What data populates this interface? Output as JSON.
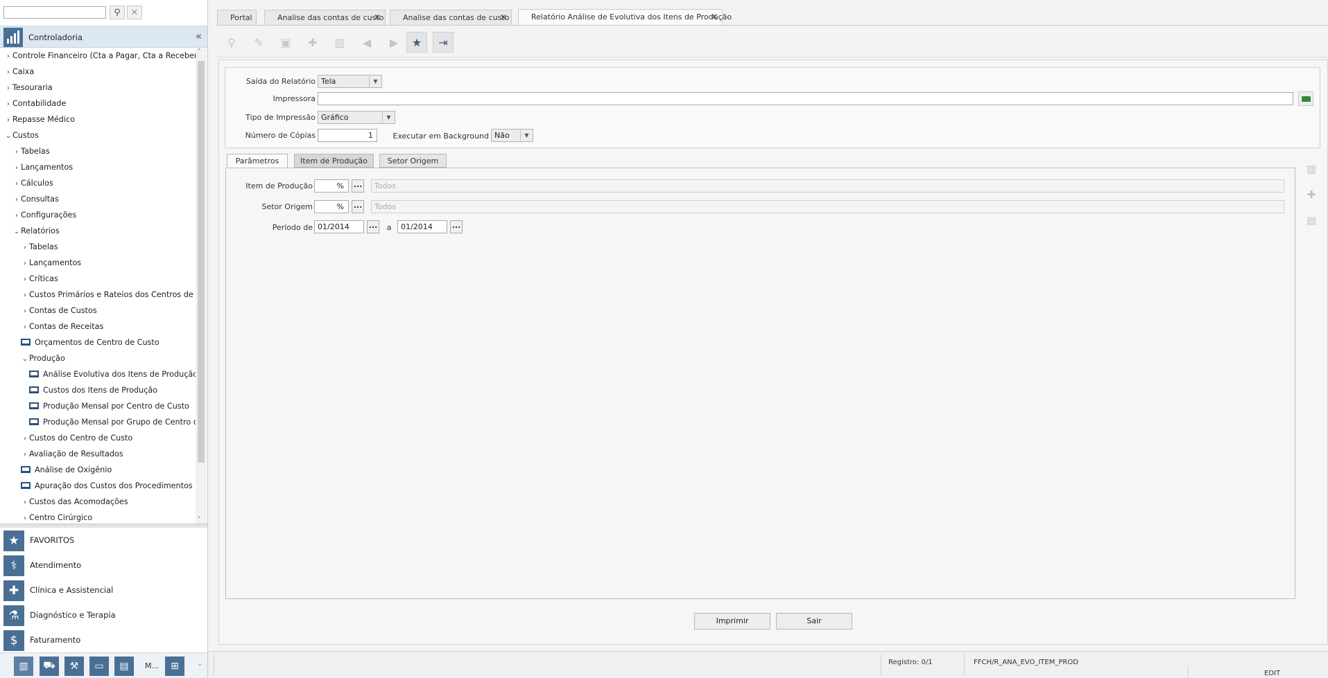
{
  "left_panel": {
    "search_placeholder": "",
    "module_title": "Controladoria",
    "collapse_glyph": "«",
    "tree": [
      {
        "label": "Controle Financeiro (Cta a Pagar, Cta a Receber, Banc",
        "level": 0,
        "state": "collapsed"
      },
      {
        "label": "Caixa",
        "level": 0,
        "state": "collapsed"
      },
      {
        "label": "Tesouraria",
        "level": 0,
        "state": "collapsed"
      },
      {
        "label": "Contabilidade",
        "level": 0,
        "state": "collapsed"
      },
      {
        "label": "Repasse Médico",
        "level": 0,
        "state": "collapsed"
      },
      {
        "label": "Custos",
        "level": 0,
        "state": "expanded"
      },
      {
        "label": "Tabelas",
        "level": 1,
        "state": "collapsed"
      },
      {
        "label": "Lançamentos",
        "level": 1,
        "state": "collapsed"
      },
      {
        "label": "Cálculos",
        "level": 1,
        "state": "collapsed"
      },
      {
        "label": "Consultas",
        "level": 1,
        "state": "collapsed"
      },
      {
        "label": "Configurações",
        "level": 1,
        "state": "collapsed"
      },
      {
        "label": "Relatórios",
        "level": 1,
        "state": "expanded"
      },
      {
        "label": "Tabelas",
        "level": 2,
        "state": "collapsed"
      },
      {
        "label": "Lançamentos",
        "level": 2,
        "state": "collapsed"
      },
      {
        "label": "Críticas",
        "level": 2,
        "state": "collapsed"
      },
      {
        "label": "Custos Primários e Rateios dos Centros de Custo",
        "level": 2,
        "state": "collapsed"
      },
      {
        "label": "Contas de Custos",
        "level": 2,
        "state": "collapsed"
      },
      {
        "label": "Contas de Receitas",
        "level": 2,
        "state": "collapsed"
      },
      {
        "label": "Orçamentos de Centro de Custo",
        "level": 2,
        "state": "leaf"
      },
      {
        "label": "Produção",
        "level": 2,
        "state": "expanded"
      },
      {
        "label": "Análise Evolutiva dos Itens de Produção",
        "level": 3,
        "state": "leaf"
      },
      {
        "label": "Custos dos Itens de Produção",
        "level": 3,
        "state": "leaf"
      },
      {
        "label": "Produção Mensal por Centro de Custo",
        "level": 3,
        "state": "leaf"
      },
      {
        "label": "Produção Mensal por Grupo de Centro de",
        "level": 3,
        "state": "leaf"
      },
      {
        "label": "Custos do Centro de Custo",
        "level": 2,
        "state": "collapsed"
      },
      {
        "label": "Avaliação de Resultados",
        "level": 2,
        "state": "collapsed"
      },
      {
        "label": "Análise de Oxigênio",
        "level": 2,
        "state": "leaf"
      },
      {
        "label": "Apuração dos Custos dos Procedimentos",
        "level": 2,
        "state": "leaf"
      },
      {
        "label": "Custos das Acomodações",
        "level": 2,
        "state": "collapsed"
      },
      {
        "label": "Centro Cirúrgico",
        "level": 2,
        "state": "collapsed"
      }
    ],
    "modules": [
      {
        "label": "FAVORITOS",
        "icon": "star-icon",
        "glyph": "★"
      },
      {
        "label": "Atendimento",
        "icon": "stethoscope-icon",
        "glyph": "⚕"
      },
      {
        "label": "Clínica e Assistencial",
        "icon": "medkit-icon",
        "glyph": "✚"
      },
      {
        "label": "Diagnóstico e Terapia",
        "icon": "microscope-icon",
        "glyph": "⚗"
      },
      {
        "label": "Faturamento",
        "icon": "dollar-icon",
        "glyph": "$"
      }
    ],
    "bottom_more_label": "M...",
    "bottom_glyph": "⌄"
  },
  "tabs": [
    {
      "label": "Portal",
      "closable": false
    },
    {
      "label": "Analise das contas de custo",
      "closable": true
    },
    {
      "label": "Analise das contas de custo",
      "closable": true
    },
    {
      "label": "Relatório Análise de Evolutiva dos Itens de Produção",
      "closable": true
    }
  ],
  "close_glyph": "✕",
  "form": {
    "saida_label": "Saída do Relatório",
    "saida_value": "Tela",
    "impressora_label": "Impressora",
    "impressora_value": "",
    "tipo_label": "Tipo de Impressão",
    "tipo_value": "Gráfico",
    "copias_label": "Número de Cópias",
    "copias_value": "1",
    "background_label": "Executar em Background",
    "background_value": "Não",
    "dropdown_glyph": "▼"
  },
  "param_tabs": [
    "Parâmetros",
    "Item de Produção",
    "Setor Origem"
  ],
  "params": {
    "item_label": "Item de Produção",
    "item_value": "%",
    "item_placeholder": "Todos",
    "setor_label": "Setor Origem",
    "setor_value": "%",
    "setor_placeholder": "Todos",
    "periodo_label": "Período de",
    "periodo_from": "01/2014",
    "periodo_sep": "a",
    "periodo_to": "01/2014",
    "ellipsis": "..."
  },
  "buttons": {
    "imprimir": "Imprimir",
    "sair": "Sair"
  },
  "status": {
    "registro": "Registro: 0/1",
    "code": "FFCH/R_ANA_EVO_ITEM_PROD",
    "mode": "EDIT"
  },
  "colors": {
    "accent": "#4a6f95",
    "header_bg": "#dce7f2",
    "folder": "#2f8a3a"
  }
}
